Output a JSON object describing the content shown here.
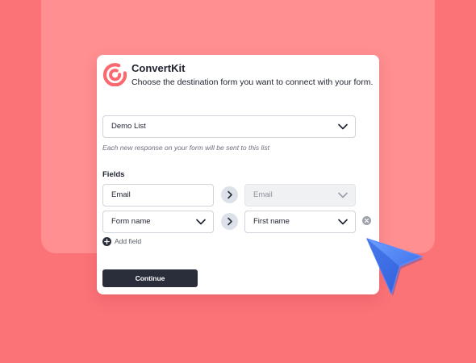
{
  "colors": {
    "background": "#fb7377",
    "backdrop": "#ff8f91",
    "card": "#ffffff",
    "brand": "#fb6970",
    "button": "#2a2e3a",
    "cursor": "#3f7cf4"
  },
  "header": {
    "app_name": "ConvertKit",
    "subtitle": "Choose the destination form you want to connect with your form.",
    "logo_icon": "convertkit-logo"
  },
  "destination": {
    "selected": "Demo List",
    "helper": "Each new response on your form will be sent to this list"
  },
  "fields": {
    "label": "Fields",
    "rows": [
      {
        "source": "Email",
        "target": "Email",
        "target_disabled": true
      },
      {
        "source": "Form name",
        "target": "First name",
        "target_disabled": false
      }
    ],
    "add_label": "Add field"
  },
  "actions": {
    "continue_label": "Continue"
  },
  "icons": {
    "chevron": "chevron-down-icon",
    "arrow": "arrow-right-icon",
    "remove": "close-circle-icon",
    "add": "plus-circle-icon",
    "cursor": "cursor-pointer-icon"
  }
}
